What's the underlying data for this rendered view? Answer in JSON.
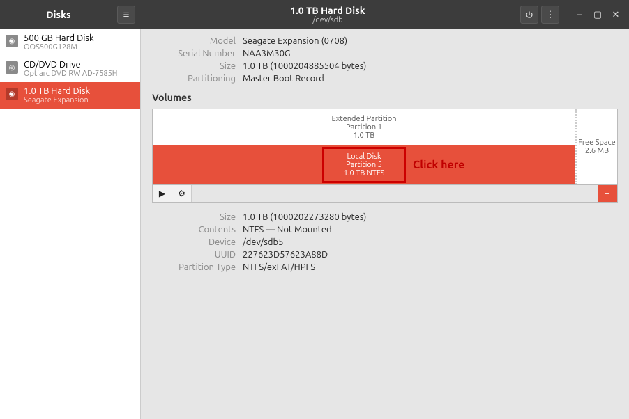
{
  "titlebar": {
    "left_title": "Disks",
    "main_title": "1.0 TB Hard Disk",
    "sub_title": "/dev/sdb"
  },
  "sidebar": {
    "items": [
      {
        "primary": "500 GB Hard Disk",
        "secondary": "OOS500G128M",
        "icon": "hdd"
      },
      {
        "primary": "CD/DVD Drive",
        "secondary": "Optiarc DVD RW AD-7585H",
        "icon": "cd"
      },
      {
        "primary": "1.0 TB Hard Disk",
        "secondary": "Seagate Expansion",
        "icon": "hdd"
      }
    ]
  },
  "drive_info": {
    "model_label": "Model",
    "model_value": "Seagate Expansion (0708)",
    "serial_label": "Serial Number",
    "serial_value": "NAA3M30G",
    "size_label": "Size",
    "size_value": "1.0 TB (1000204885504 bytes)",
    "partitioning_label": "Partitioning",
    "partitioning_value": "Master Boot Record"
  },
  "volumes_header": "Volumes",
  "volumes": {
    "extended": {
      "l1": "Extended Partition",
      "l2": "Partition 1",
      "l3": "1.0 TB"
    },
    "logical": {
      "l1": "Local Disk",
      "l2": "Partition 5",
      "l3": "1.0 TB NTFS"
    },
    "free": {
      "l1": "Free Space",
      "l2": "2.6 MB"
    }
  },
  "annotation": {
    "label": "Click here"
  },
  "partition_info": {
    "size_label": "Size",
    "size_value": "1.0 TB (1000202273280 bytes)",
    "contents_label": "Contents",
    "contents_value": "NTFS — Not Mounted",
    "device_label": "Device",
    "device_value": "/dev/sdb5",
    "uuid_label": "UUID",
    "uuid_value": "227623D57623A88D",
    "type_label": "Partition Type",
    "type_value": "NTFS/exFAT/HPFS"
  },
  "colors": {
    "accent": "#e7503b"
  }
}
